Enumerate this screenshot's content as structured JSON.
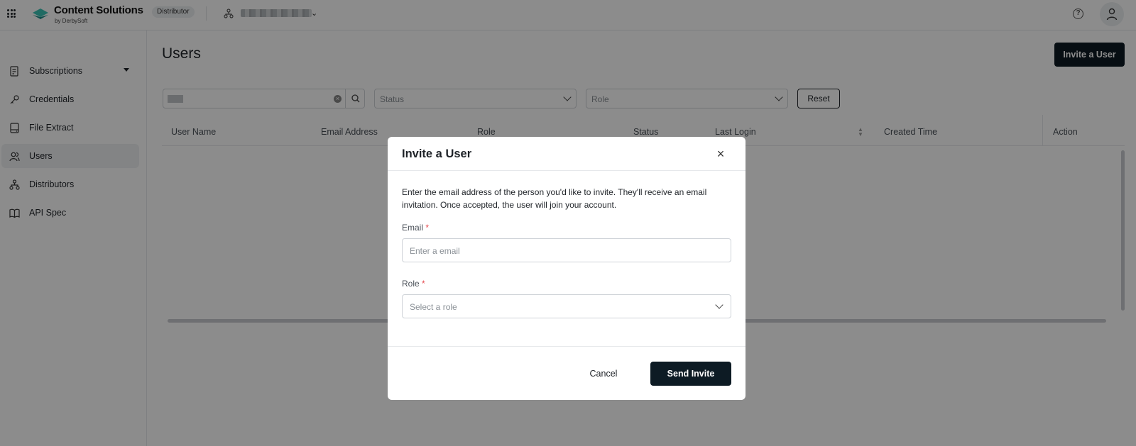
{
  "header": {
    "brand_title": "Content Solutions",
    "brand_subtitle": "by DerbySoft",
    "badge": "Distributor",
    "help_glyph": "?",
    "icons": [
      "apps-grid-icon",
      "logo-icon",
      "org-icon",
      "chevron-down-icon",
      "help-icon",
      "user-icon"
    ]
  },
  "sidebar": {
    "items": [
      {
        "label": "Subscriptions",
        "icon": "subscriptions-icon"
      },
      {
        "label": "Credentials",
        "icon": "key-icon"
      },
      {
        "label": "File Extract",
        "icon": "file-extract-icon"
      },
      {
        "label": "Users",
        "icon": "users-icon",
        "active": true
      },
      {
        "label": "Distributors",
        "icon": "distributors-icon"
      },
      {
        "label": "API Spec",
        "icon": "book-icon"
      }
    ]
  },
  "main": {
    "title": "Users",
    "invite_button": "Invite a User",
    "filters": {
      "status_placeholder": "Status",
      "role_placeholder": "Role",
      "reset": "Reset"
    },
    "table": {
      "columns": [
        "User Name",
        "Email Address",
        "Role",
        "Status",
        "Last Login",
        "Created Time",
        "Action"
      ]
    }
  },
  "modal": {
    "title": "Invite a User",
    "close_glyph": "×",
    "description": "Enter the email address of the person you'd like to invite. They'll receive an email invitation. Once accepted, the user will join your account.",
    "email_label": "Email",
    "email_placeholder": "Enter a email",
    "role_label": "Role",
    "role_placeholder": "Select a role",
    "required_mark": "*",
    "cancel": "Cancel",
    "send": "Send Invite"
  },
  "colors": {
    "primary_button": "#0d1b24",
    "brand_teal": "#1fa7a0",
    "required": "#e5484d",
    "active_nav_bg": "#eef0f3"
  }
}
